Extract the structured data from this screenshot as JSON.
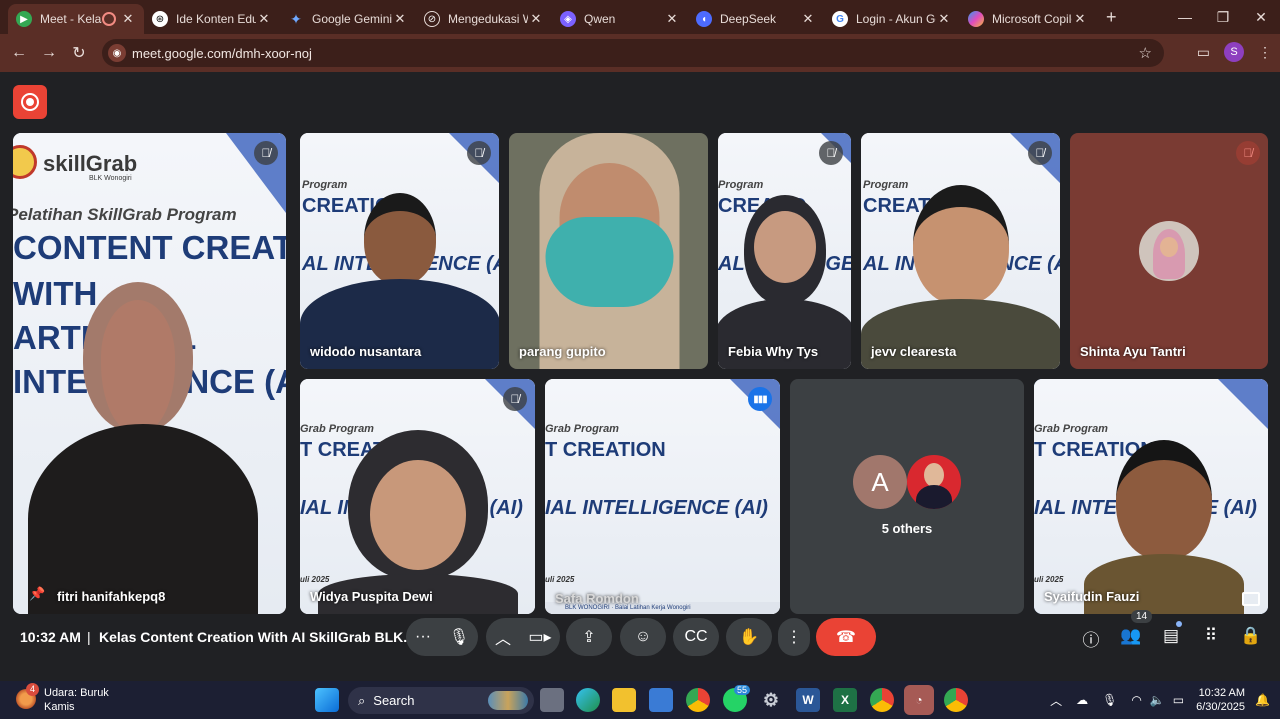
{
  "browser": {
    "tabs": [
      {
        "title": "Meet - Kelas C",
        "favicon": "meet-icon",
        "active": true
      },
      {
        "title": "Ide Konten Eduka",
        "favicon": "chatgpt-icon"
      },
      {
        "title": "Google Gemini",
        "favicon": "gemini-icon"
      },
      {
        "title": "Mengedukasi Wa",
        "favicon": "openai-icon"
      },
      {
        "title": "Qwen",
        "favicon": "qwen-icon"
      },
      {
        "title": "DeepSeek",
        "favicon": "deepseek-icon"
      },
      {
        "title": "Login - Akun Goo",
        "favicon": "google-icon"
      },
      {
        "title": "Microsoft Copilot",
        "favicon": "copilot-icon"
      }
    ],
    "url": "meet.google.com/dmh-xoor-noj",
    "profile_initial": "S"
  },
  "meet": {
    "participants": {
      "fitri": "fitri hanifahkepq8",
      "widodo": "widodo nusantara",
      "parang": "parang gupito",
      "febia": "Febia Why Tys",
      "jevv": "jevv clearesta",
      "shinta": "Shinta Ayu Tantri",
      "widya": "Widya Puspita Dewi",
      "safa": "Safa Romdon",
      "syaifudin": "Syaifudin Fauzi"
    },
    "others": {
      "label": "5 others",
      "avatar_letter": "A"
    },
    "slide": {
      "brand": "skillGrab",
      "brand_sub": "BLK Wonogiri",
      "line1": "Pelatihan SkillGrab Program",
      "line2": "CONTENT CREATION",
      "line3": "WITH",
      "line4": "ARTIFICIAL",
      "line5": "INTELLIGENCE (AI)",
      "t_program": "Program",
      "t_creatio": "CREATIO",
      "t_ai": "AL INTELLIGENCE (AI)",
      "t_grab_program": "Grab Program",
      "t_creation": "T CREATION",
      "t_ai2": "IAL INTELLIGENCE (AI)",
      "t_date": "uli 2025",
      "t_footer": "Balai Latihan Kerja Wonogiri",
      "t_footer2": "BLK WONOGIRI"
    },
    "controls": {
      "time": "10:32 AM",
      "separator": "|",
      "meeting_title": "Kelas Content Creation With AI SkillGrab BLK...",
      "people_count": "14"
    }
  },
  "taskbar": {
    "weather_line1": "Udara: Buruk",
    "weather_line2": "Kamis",
    "weather_badge": "4",
    "search_label": "Search",
    "whatsapp_badge": "55",
    "clock_time": "10:32 AM",
    "clock_date": "6/30/2025"
  }
}
